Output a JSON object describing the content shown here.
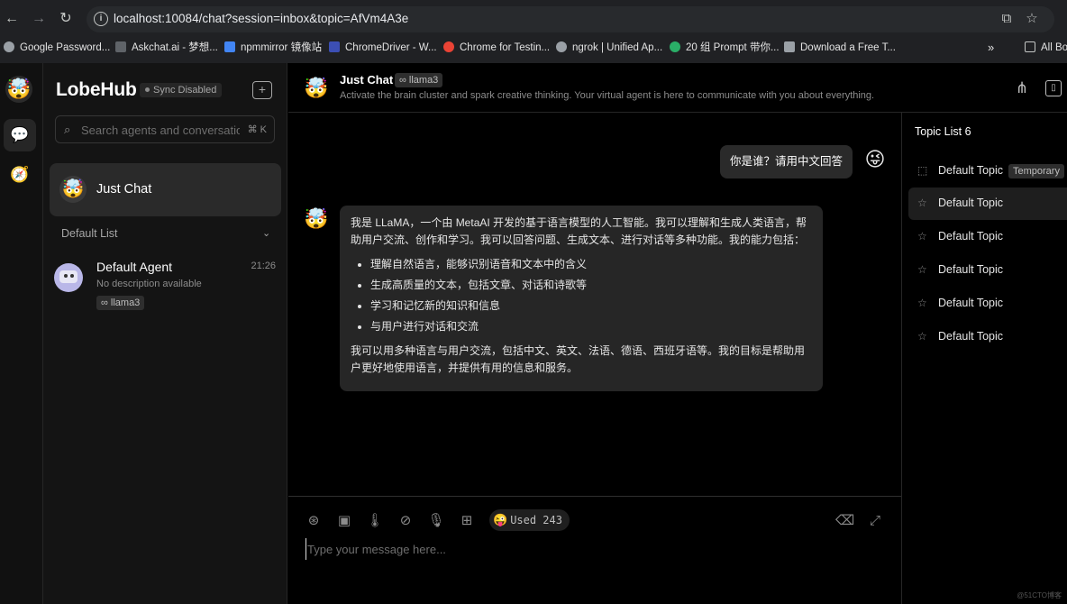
{
  "browser": {
    "url": "localhost:10084/chat?session=inbox&topic=AfVm4A3e",
    "bookmarks": [
      {
        "label": "Google Password...",
        "color": "#9aa0a6"
      },
      {
        "label": "Askchat.ai - 梦想...",
        "color": "#5f6368"
      },
      {
        "label": "npmmirror 镜像站",
        "color": "#4285f4"
      },
      {
        "label": "ChromeDriver - W...",
        "color": "#3c4fb4"
      },
      {
        "label": "Chrome for Testin...",
        "color": "#ea4335"
      },
      {
        "label": "ngrok | Unified Ap...",
        "color": "#9aa0a6"
      },
      {
        "label": "20 组 Prompt 带你...",
        "color": "#2aae67"
      },
      {
        "label": "Download a Free T...",
        "color": "#9aa0a6"
      },
      {
        "label": "All Bo",
        "color": "#9aa0a6"
      }
    ]
  },
  "sidebar": {
    "brand": "LobeHub",
    "sync_status": "Sync Disabled",
    "search_placeholder": "Search agents and conversations...",
    "search_shortcut": "⌘ K",
    "active_session": {
      "title": "Just Chat",
      "avatar": "🤯"
    },
    "group_label": "Default List",
    "agent": {
      "name": "Default Agent",
      "time": "21:26",
      "desc": "No description available",
      "model": "∞ llama3"
    }
  },
  "header": {
    "title": "Just Chat",
    "model": "∞ llama3",
    "description": "Activate the brain cluster and spark creative thinking. Your virtual agent is here to communicate with you about everything."
  },
  "messages": {
    "user": "你是谁？请用中文回答",
    "bot_intro": "我是 LLaMA，一个由 MetaAI 开发的基于语言模型的人工智能。我可以理解和生成人类语言，帮助用户交流、创作和学习。我可以回答问题、生成文本、进行对话等多种功能。我的能力包括：",
    "bot_list": [
      "理解自然语言，能够识别语音和文本中的含义",
      "生成高质量的文本，包括文章、对话和诗歌等",
      "学习和记忆新的知识和信息",
      "与用户进行对话和交流"
    ],
    "bot_outro": "我可以用多种语言与用户交流，包括中文、英文、法语、德语、西班牙语等。我的目标是帮助用户更好地使用语言，并提供有用的信息和服务。"
  },
  "input": {
    "token_label": "Used 243",
    "placeholder": "Type your message here..."
  },
  "topics": {
    "header": "Topic List 6",
    "temporary_label": "Temporary",
    "items": [
      "Default Topic",
      "Default Topic",
      "Default Topic",
      "Default Topic",
      "Default Topic",
      "Default Topic"
    ]
  },
  "watermark": "@51CTO博客"
}
